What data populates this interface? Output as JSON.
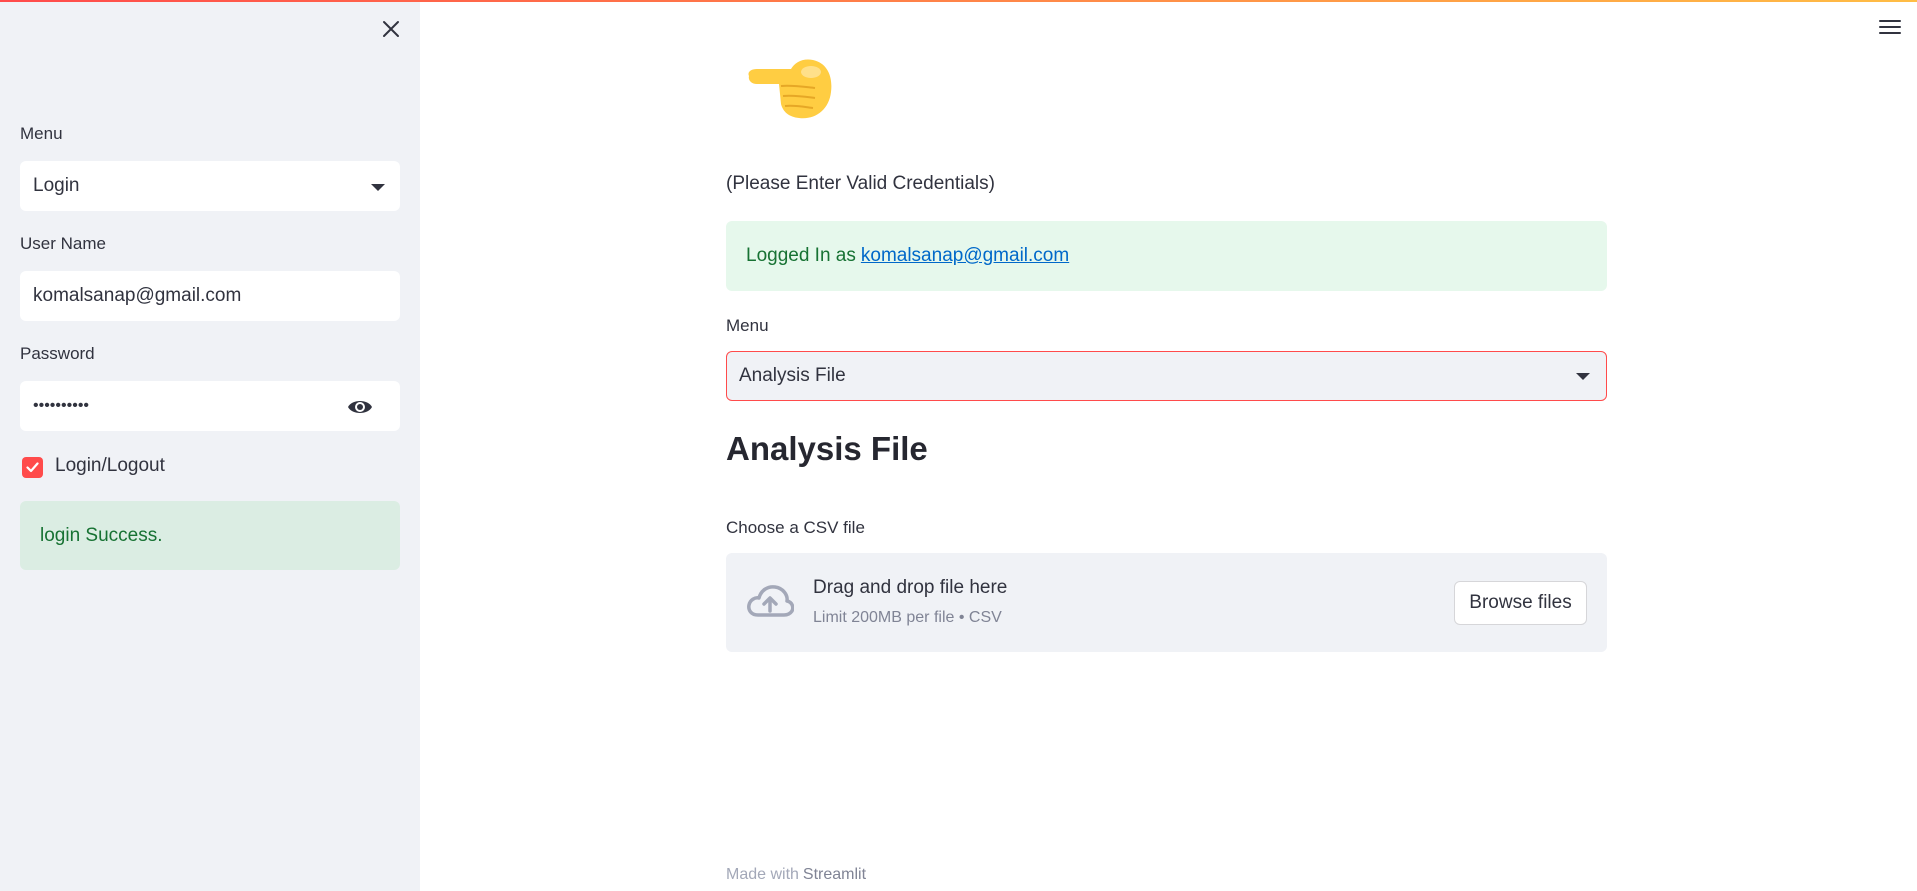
{
  "sidebar": {
    "menu_label": "Menu",
    "menu_value": "Login",
    "username_label": "User Name",
    "username_value": "komalsanap@gmail.com",
    "password_label": "Password",
    "password_masked": "••••••••••",
    "checkbox_label": "Login/Logout",
    "checkbox_checked": true,
    "success_message": "login Success."
  },
  "main": {
    "emoji": "👉",
    "note": "(Please Enter Valid Credentials)",
    "logged_prefix": "Logged In as",
    "logged_email": "komalsanap@gmail.com",
    "menu_label": "Menu",
    "menu_value": "Analysis File",
    "heading": "Analysis File",
    "upload_label": "Choose a CSV file",
    "dropzone_title": "Drag and drop file here",
    "dropzone_subtitle": "Limit 200MB per file • CSV",
    "browse_button": "Browse files"
  },
  "footer": {
    "prefix": "Made with",
    "brand": "Streamlit"
  },
  "colors": {
    "accent": "#ff4b4b",
    "sidebar_bg": "#f0f2f6",
    "success_bg": "#dbede3",
    "success_text": "#177233",
    "link": "#0068c9"
  },
  "icons": [
    "close-icon",
    "chevron-down-icon",
    "eye-icon",
    "check-icon",
    "hamburger-menu-icon",
    "cloud-upload-icon",
    "pointing-hand-emoji"
  ]
}
